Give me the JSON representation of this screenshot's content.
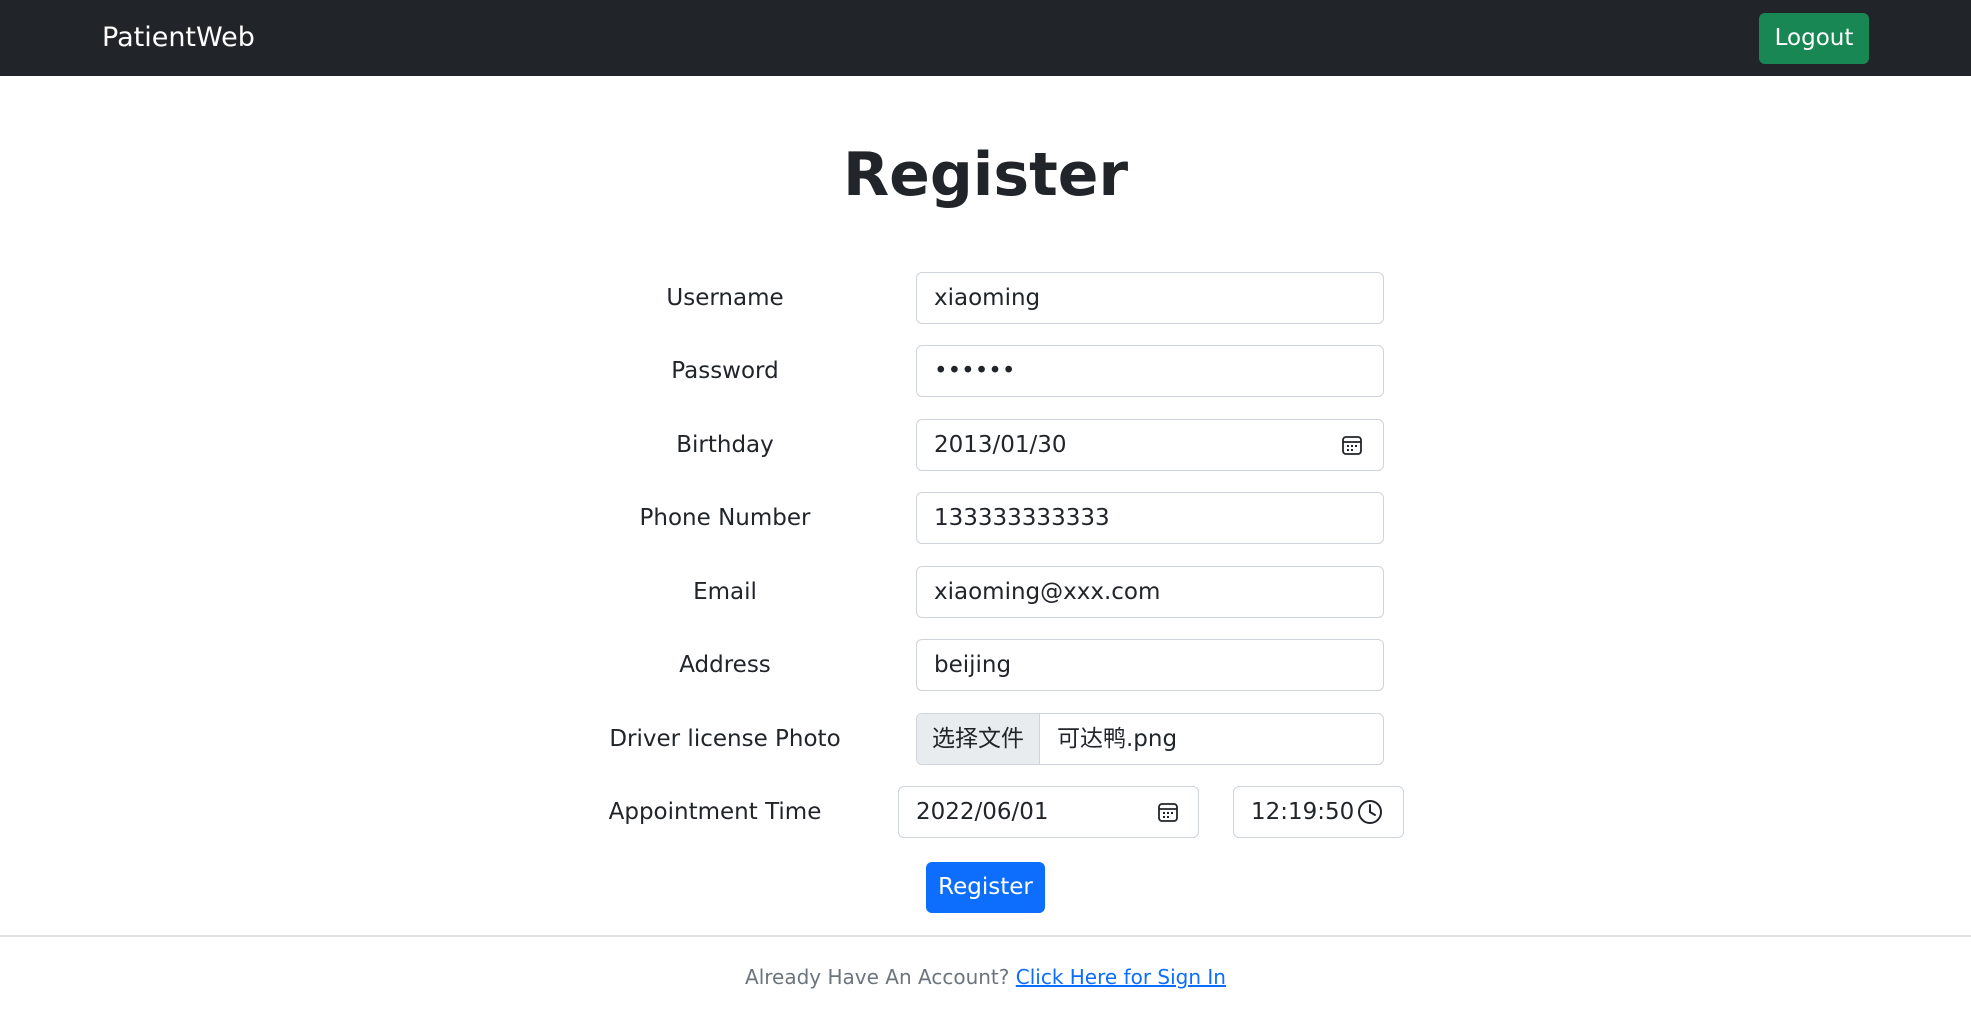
{
  "navbar": {
    "brand": "PatientWeb",
    "logout_label": "Logout",
    "colors": {
      "background": "#212529",
      "logout": "#198754"
    }
  },
  "page": {
    "title": "Register"
  },
  "form": {
    "username": {
      "label": "Username",
      "value": "xiaoming"
    },
    "password": {
      "label": "Password",
      "value": "••••••"
    },
    "birthday": {
      "label": "Birthday",
      "value": "2013/01/30",
      "icon": "calendar-icon"
    },
    "phone": {
      "label": "Phone Number",
      "value": "133333333333"
    },
    "email": {
      "label": "Email",
      "value": "xiaoming@xxx.com"
    },
    "address": {
      "label": "Address",
      "value": "beijing"
    },
    "driver_license": {
      "label": "Driver license Photo",
      "button_label": "选择文件",
      "file_name": "可达鸭.png"
    },
    "appointment": {
      "label": "Appointment Time",
      "date": "2022/06/01",
      "time": "12:19:50",
      "date_icon": "calendar-icon",
      "time_icon": "clock-icon"
    },
    "submit_label": "Register",
    "submit_color": "#0d6efd"
  },
  "footer": {
    "prompt": "Already Have An Account?",
    "link_text": "Click Here for Sign In"
  }
}
